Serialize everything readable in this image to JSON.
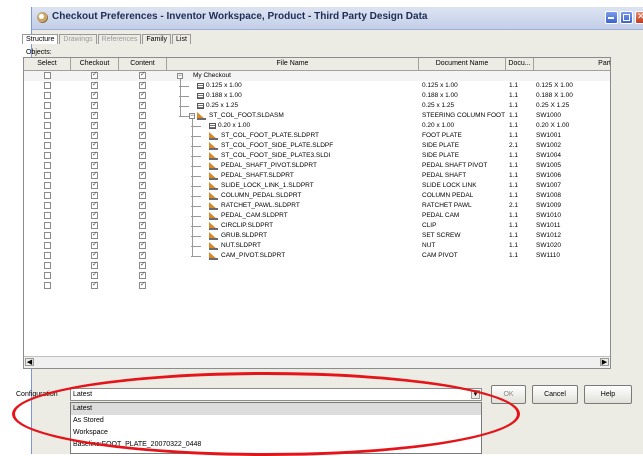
{
  "window": {
    "title": "Checkout Preferences - Inventor Workspace, Product - Third Party Design Data"
  },
  "tabs": [
    {
      "label": "Structure",
      "state": "active"
    },
    {
      "label": "Drawings",
      "state": "disabled"
    },
    {
      "label": "References",
      "state": "disabled"
    },
    {
      "label": "Family",
      "state": "normal"
    },
    {
      "label": "List",
      "state": "normal"
    }
  ],
  "objects_label": "Objects:",
  "table": {
    "columns": [
      "Select",
      "Checkout",
      "Content",
      "File Name",
      "Document Name",
      "Docu...",
      "Part"
    ],
    "rows": [
      {
        "select": false,
        "checkout": true,
        "content": true,
        "depth": 0,
        "icon": "none",
        "expander": "minus",
        "file": "My Checkout",
        "doc": "",
        "rev": "",
        "part": ""
      },
      {
        "select": false,
        "checkout": true,
        "content": true,
        "depth": 1,
        "icon": "table-icon",
        "expander": "",
        "file": "0.125 x 1.00",
        "doc": "0.125 x 1.00",
        "rev": "1.1",
        "part": "0.125 X 1.00"
      },
      {
        "select": false,
        "checkout": true,
        "content": true,
        "depth": 1,
        "icon": "table-icon",
        "expander": "",
        "file": "0.188 x 1.00",
        "doc": "0.188 x 1.00",
        "rev": "1.1",
        "part": "0.188 X 1.00"
      },
      {
        "select": false,
        "checkout": true,
        "content": true,
        "depth": 1,
        "icon": "table-icon",
        "expander": "",
        "file": "0.25 x 1.25",
        "doc": "0.25 x 1.25",
        "rev": "1.1",
        "part": "0.25 X 1.25"
      },
      {
        "select": false,
        "checkout": true,
        "content": true,
        "depth": 1,
        "icon": "assembly-icon",
        "expander": "minus",
        "file": "ST_COL_FOOT.SLDASM",
        "doc": "STEERING COLUMN FOOT",
        "rev": "1.1",
        "part": "SW1000"
      },
      {
        "select": false,
        "checkout": true,
        "content": true,
        "depth": 2,
        "icon": "table-icon",
        "expander": "",
        "file": "0.20 x 1.00",
        "doc": "0.20 x 1.00",
        "rev": "1.1",
        "part": "0.20 X 1.00"
      },
      {
        "select": false,
        "checkout": true,
        "content": true,
        "depth": 2,
        "icon": "part-icon",
        "expander": "",
        "file": "ST_COL_FOOT_PLATE.SLDPRT",
        "doc": "FOOT PLATE",
        "rev": "1.1",
        "part": "SW1001"
      },
      {
        "select": false,
        "checkout": true,
        "content": true,
        "depth": 2,
        "icon": "part-icon",
        "expander": "",
        "file": "ST_COL_FOOT_SIDE_PLATE.SLDPF",
        "doc": "SIDE PLATE",
        "rev": "2.1",
        "part": "SW1002"
      },
      {
        "select": false,
        "checkout": true,
        "content": true,
        "depth": 2,
        "icon": "part-icon",
        "expander": "",
        "file": "ST_COL_FOOT_SIDE_PLATE3.SLDI",
        "doc": "SIDE PLATE",
        "rev": "1.1",
        "part": "SW1004"
      },
      {
        "select": false,
        "checkout": true,
        "content": true,
        "depth": 2,
        "icon": "part-icon",
        "expander": "",
        "file": "PEDAL_SHAFT_PIVOT.SLDPRT",
        "doc": "PEDAL SHAFT PIVOT",
        "rev": "1.1",
        "part": "SW1005"
      },
      {
        "select": false,
        "checkout": true,
        "content": true,
        "depth": 2,
        "icon": "part-icon",
        "expander": "",
        "file": "PEDAL_SHAFT.SLDPRT",
        "doc": "PEDAL SHAFT",
        "rev": "1.1",
        "part": "SW1006"
      },
      {
        "select": false,
        "checkout": true,
        "content": true,
        "depth": 2,
        "icon": "part-icon",
        "expander": "",
        "file": "SLIDE_LOCK_LINK_1.SLDPRT",
        "doc": "SLIDE LOCK LINK",
        "rev": "1.1",
        "part": "SW1007"
      },
      {
        "select": false,
        "checkout": true,
        "content": true,
        "depth": 2,
        "icon": "part-icon",
        "expander": "",
        "file": "COLUMN_PEDAL.SLDPRT",
        "doc": "COLUMN PEDAL",
        "rev": "1.1",
        "part": "SW1008"
      },
      {
        "select": false,
        "checkout": true,
        "content": true,
        "depth": 2,
        "icon": "part-icon",
        "expander": "",
        "file": "RATCHET_PAWL.SLDPRT",
        "doc": "RATCHET PAWL",
        "rev": "2.1",
        "part": "SW1009"
      },
      {
        "select": false,
        "checkout": true,
        "content": true,
        "depth": 2,
        "icon": "part-icon",
        "expander": "",
        "file": "PEDAL_CAM.SLDPRT",
        "doc": "PEDAL CAM",
        "rev": "1.1",
        "part": "SW1010"
      },
      {
        "select": false,
        "checkout": true,
        "content": true,
        "depth": 2,
        "icon": "part-icon",
        "expander": "",
        "file": "CIRCLIP.SLDPRT",
        "doc": "CLIP",
        "rev": "1.1",
        "part": "SW1011"
      },
      {
        "select": false,
        "checkout": true,
        "content": true,
        "depth": 2,
        "icon": "part-icon",
        "expander": "",
        "file": "GRUB.SLDPRT",
        "doc": "SET SCREW",
        "rev": "1.1",
        "part": "SW1012"
      },
      {
        "select": false,
        "checkout": true,
        "content": true,
        "depth": 2,
        "icon": "part-icon",
        "expander": "",
        "file": "NUT.SLDPRT",
        "doc": "NUT",
        "rev": "1.1",
        "part": "SW1020"
      },
      {
        "select": false,
        "checkout": true,
        "content": true,
        "depth": 2,
        "icon": "part-icon",
        "expander": "",
        "file": "CAM_PIVOT.SLDPRT",
        "doc": "CAM PIVOT",
        "rev": "1.1",
        "part": "SW1110"
      },
      {
        "select": false,
        "checkout": true,
        "content": true,
        "depth": 0,
        "icon": "none",
        "expander": "",
        "file": "",
        "doc": "",
        "rev": "",
        "part": ""
      },
      {
        "select": false,
        "checkout": true,
        "content": true,
        "depth": 0,
        "icon": "none",
        "expander": "",
        "file": "",
        "doc": "",
        "rev": "",
        "part": ""
      },
      {
        "select": false,
        "checkout": true,
        "content": true,
        "depth": 0,
        "icon": "none",
        "expander": "",
        "file": "",
        "doc": "",
        "rev": "",
        "part": ""
      }
    ]
  },
  "configuration": {
    "label": "Configuration",
    "value": "Latest",
    "options": [
      "Latest",
      "As Stored",
      "Workspace",
      "Baseline:FOOT_PLATE_20070322_0448"
    ]
  },
  "buttons": {
    "ok": "OK",
    "cancel": "Cancel",
    "help": "Help"
  },
  "colors": {
    "annotation": "#e51419",
    "title_text": "#1d2d55",
    "part_icon": "#d88a2a"
  }
}
